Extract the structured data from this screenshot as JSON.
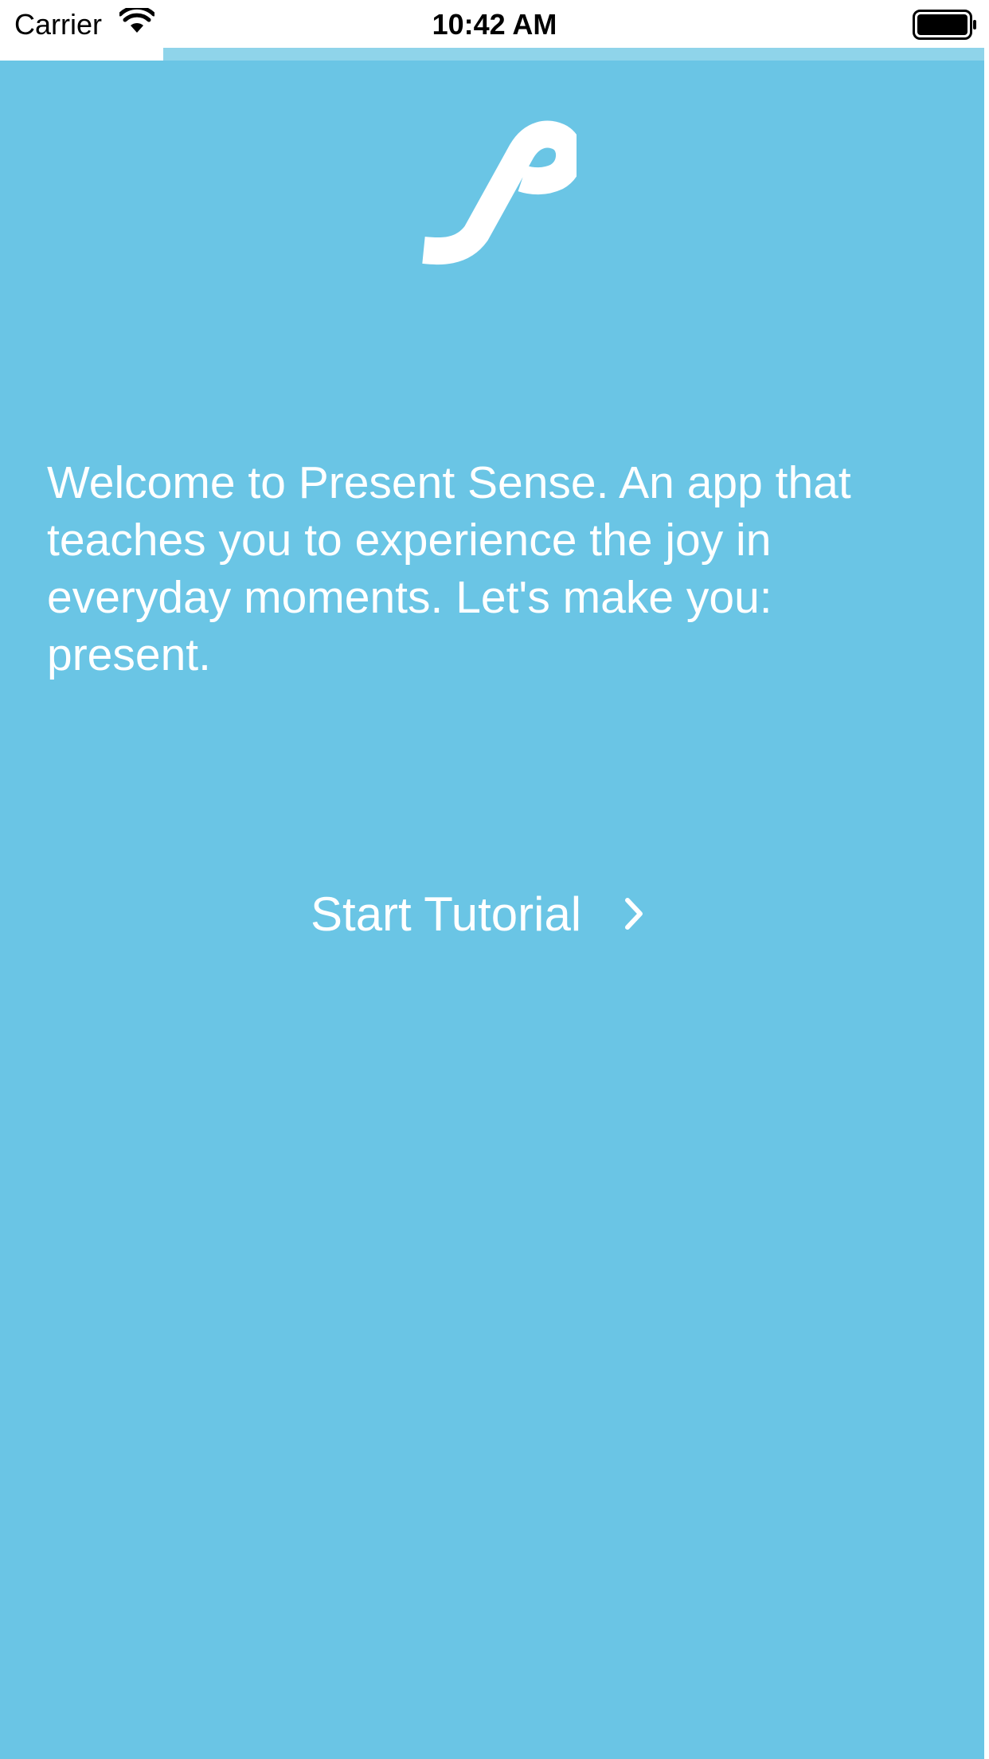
{
  "status_bar": {
    "carrier": "Carrier",
    "time": "10:42 AM",
    "wifi_icon": "wifi-icon",
    "battery_icon": "battery-full-icon"
  },
  "onboarding": {
    "progress": 0.165,
    "logo_icon": "present-sense-logo-icon",
    "welcome": "Welcome to Present Sense. An app that teaches you to experience the joy in everyday moments. Let's make you: present.",
    "start_button": {
      "label": "Start Tutorial",
      "icon": "chevron-right-icon"
    }
  },
  "colors": {
    "background": "#6ac5e5",
    "progress_track": "#8fd4ea",
    "text": "#ffffff"
  }
}
